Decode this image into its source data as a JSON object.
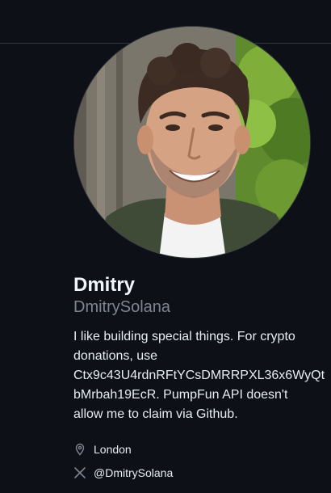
{
  "profile": {
    "avatar_alt": "Dmitry",
    "name": "Dmitry",
    "username": "DmitrySolana",
    "bio_lines": [
      "I like building special things. For crypto",
      "donations, use",
      "Ctx9c43U4rdnRFtYCsDMRRPXL36x6WyQt",
      "bMrbah19EcR. PumpFun API doesn't",
      "allow me to claim via Github."
    ],
    "location": "London",
    "social_handle": "@DmitrySolana"
  },
  "icons": {
    "location": "location-pin-icon",
    "social": "x-logo-icon"
  },
  "colors": {
    "background": "#0d1117",
    "text_primary": "#e6edf3",
    "text_muted": "#7d8590",
    "divider": "#30363d"
  }
}
